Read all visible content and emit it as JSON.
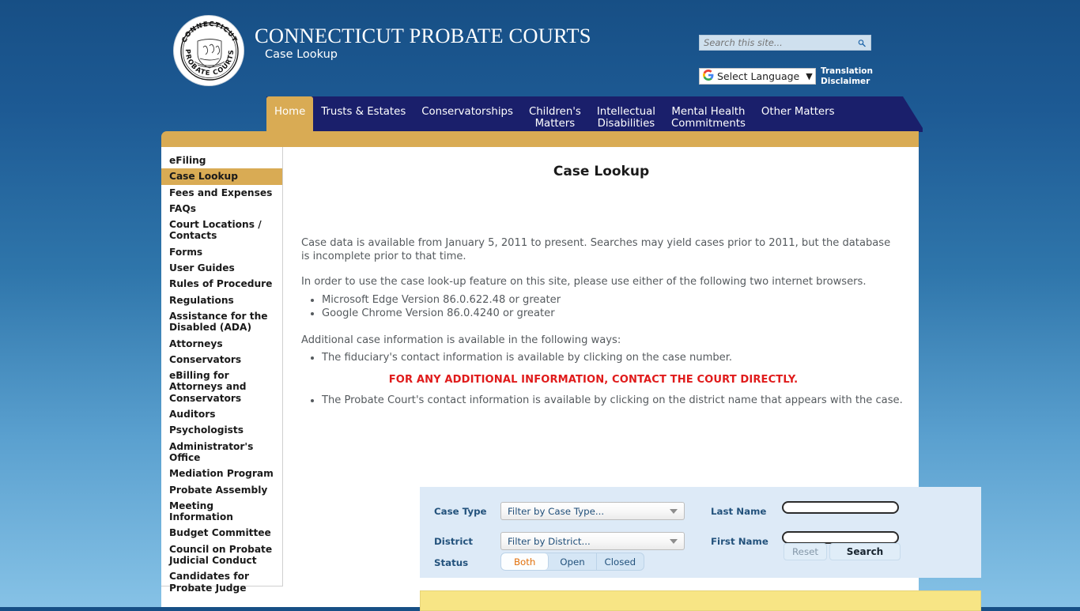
{
  "header": {
    "seal_top_text": "CONNECTICUT",
    "seal_bottom_text": "PROBATE COURTS",
    "title": "CONNECTICUT PROBATE COURTS",
    "subtitle": "Case Lookup",
    "search": {
      "placeholder": "Search this site...",
      "value": "",
      "icon": "search-icon"
    },
    "translate": {
      "label": "Select Language",
      "caret": "▼",
      "disclaimer": "Translation Disclaimer",
      "icon": "google-g-icon"
    }
  },
  "nav": {
    "items": [
      {
        "label": "Home",
        "active": true
      },
      {
        "label": "Trusts & Estates",
        "active": false
      },
      {
        "label": "Conservatorships",
        "active": false
      },
      {
        "label": "Children's\nMatters",
        "active": false
      },
      {
        "label": "Intellectual\nDisabilities",
        "active": false
      },
      {
        "label": "Mental Health\nCommitments",
        "active": false
      },
      {
        "label": "Other Matters",
        "active": false
      }
    ]
  },
  "sidebar": {
    "items": [
      {
        "label": "eFiling",
        "active": false
      },
      {
        "label": "Case Lookup",
        "active": true
      },
      {
        "label": "Fees and Expenses",
        "active": false
      },
      {
        "label": "FAQs",
        "active": false
      },
      {
        "label": "Court Locations / Contacts",
        "active": false
      },
      {
        "label": "Forms",
        "active": false
      },
      {
        "label": "User Guides",
        "active": false
      },
      {
        "label": "Rules of Procedure",
        "active": false
      },
      {
        "label": "Regulations",
        "active": false
      },
      {
        "label": "Assistance for the Disabled (ADA)",
        "active": false
      },
      {
        "label": "Attorneys",
        "active": false
      },
      {
        "label": "Conservators",
        "active": false
      },
      {
        "label": "eBilling for Attorneys and Conservators",
        "active": false
      },
      {
        "label": "Auditors",
        "active": false
      },
      {
        "label": "Psychologists",
        "active": false
      },
      {
        "label": "Administrator's Office",
        "active": false
      },
      {
        "label": "Mediation Program",
        "active": false
      },
      {
        "label": "Probate Assembly",
        "active": false
      },
      {
        "label": "Meeting Information",
        "active": false
      },
      {
        "label": "Budget Committee",
        "active": false
      },
      {
        "label": "Council on Probate Judicial Conduct",
        "active": false
      },
      {
        "label": "Candidates for Probate Judge",
        "active": false
      }
    ]
  },
  "content": {
    "title": "Case Lookup",
    "paragraph_1": "Case data is available from January 5, 2011 to present. Searches may yield cases prior to 2011, but the database is incomplete prior to that time.",
    "paragraph_2": "In order to use the case look-up feature on this site, please use either of the following two internet browsers.",
    "browser_list": [
      "Microsoft Edge Version 86.0.622.48 or greater",
      "Google Chrome Version 86.0.4240 or greater"
    ],
    "paragraph_3": "Additional case information is available in the following ways:",
    "info_bullet_1": "The fiduciary's contact information is available by clicking on the case number.",
    "warning": "FOR ANY ADDITIONAL INFORMATION, CONTACT THE COURT DIRECTLY.",
    "info_bullet_2": "The Probate Court's contact information is available by clicking on the district name that appears with the case."
  },
  "filter_panel": {
    "case_type_label": "Case Type",
    "case_type_value": "Filter by Case Type...",
    "district_label": "District",
    "district_value": "Filter by District...",
    "status_label": "Status",
    "status_options": [
      {
        "label": "Both",
        "selected": true
      },
      {
        "label": "Open",
        "selected": false
      },
      {
        "label": "Closed",
        "selected": false
      }
    ],
    "last_name_label": "Last Name",
    "last_name_value": "",
    "first_name_label": "First Name",
    "first_name_value": "",
    "reset_label": "Reset",
    "search_label": "Search"
  },
  "colors": {
    "page_gradient_top": "#174f85",
    "page_gradient_bottom": "#86c2e6",
    "nav_navy": "#1a1f6b",
    "gold": "#d9ab54",
    "warning_red": "#e01b1b",
    "panel_blue": "#ddeaf7",
    "yellow_bar": "#f7e585",
    "selected_segment_text": "#e2700a"
  }
}
